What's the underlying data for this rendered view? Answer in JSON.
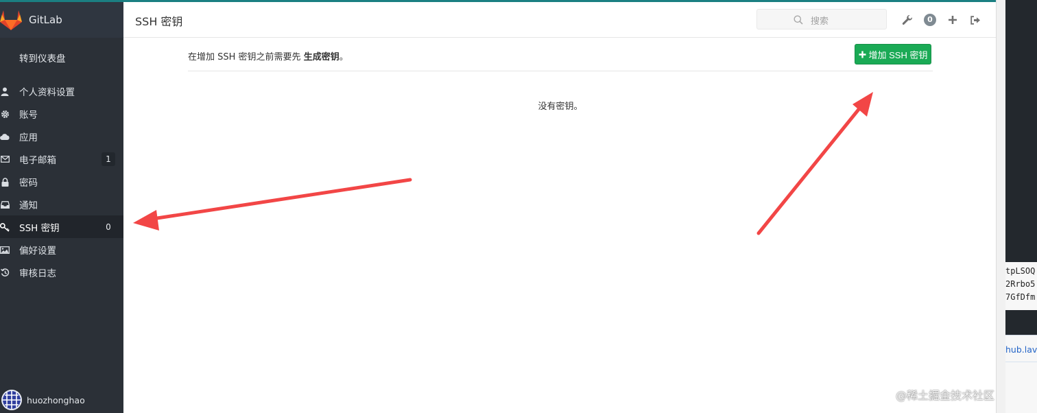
{
  "brand": {
    "name": "GitLab"
  },
  "sidebar": {
    "dashboard_link": "转到仪表盘",
    "items": [
      {
        "label": "个人资料设置",
        "icon": "user-icon"
      },
      {
        "label": "账号",
        "icon": "gear-icon"
      },
      {
        "label": "应用",
        "icon": "cloud-icon"
      },
      {
        "label": "电子邮箱",
        "icon": "envelope-icon",
        "count": "1"
      },
      {
        "label": "密码",
        "icon": "lock-icon"
      },
      {
        "label": "通知",
        "icon": "inbox-icon"
      },
      {
        "label": "SSH 密钥",
        "icon": "key-icon",
        "count": "0",
        "active": true
      },
      {
        "label": "偏好设置",
        "icon": "image-icon"
      },
      {
        "label": "审核日志",
        "icon": "history-icon"
      }
    ],
    "user": {
      "name": "huozhonghao"
    }
  },
  "header": {
    "title": "SSH 密钥",
    "search_placeholder": "搜索",
    "todo_count": "0"
  },
  "content": {
    "hint_prefix": "在增加 SSH 密钥之前需要先",
    "hint_link": "生成密钥",
    "hint_suffix": "。",
    "add_button": "增加 SSH 密钥",
    "empty_message": "没有密钥。"
  },
  "background_window": {
    "lines": [
      "tpLSOQ",
      "2Rrbo5",
      "7GfDfm"
    ],
    "link_text": "hub.lava"
  },
  "watermark": "@稀土掘金技术社区",
  "colors": {
    "sidebar": "#2b3037",
    "active_item": "#21252b",
    "primary_button": "#1aaa55",
    "annotation_arrow": "#f24646"
  }
}
